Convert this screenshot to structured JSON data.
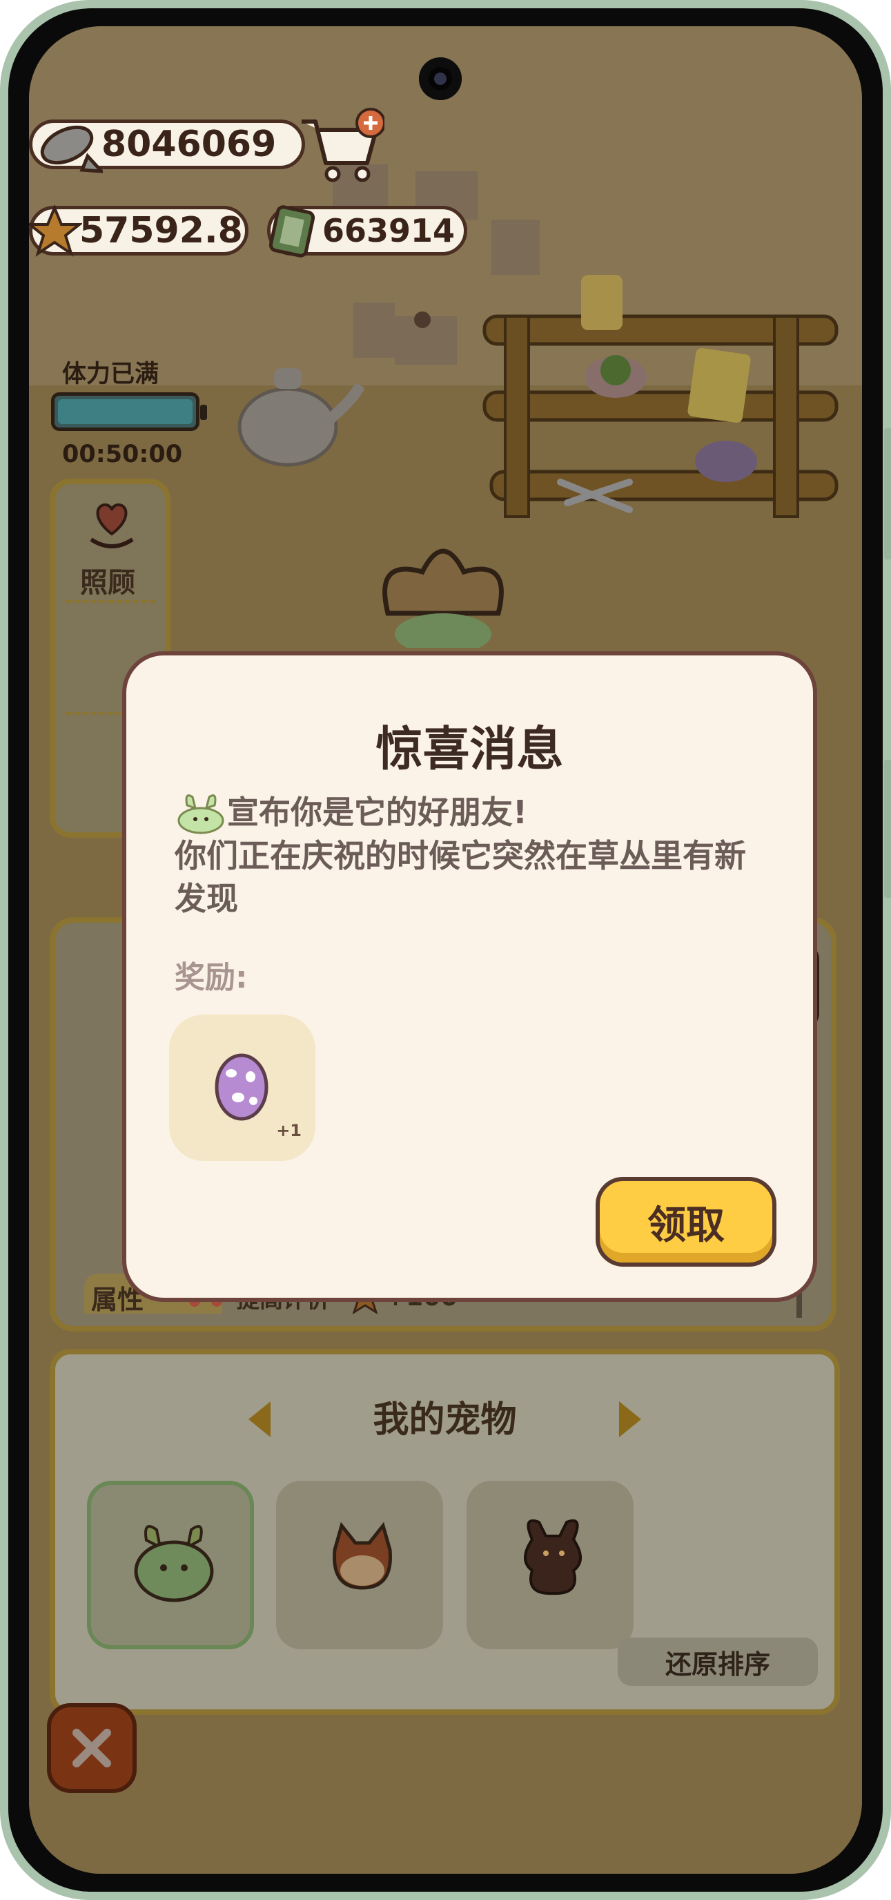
{
  "currencies": {
    "fish": "8046069",
    "stars": "57592.8",
    "tickets": "663914"
  },
  "stamina": {
    "label": "体力已满",
    "timer": "00:50:00",
    "level": 1.0
  },
  "side_menu": {
    "items": [
      {
        "label": "照顾"
      }
    ]
  },
  "attribute": {
    "tab_label": "属性",
    "improve_label": "提高评价",
    "bonus": "+100"
  },
  "pets_panel": {
    "title": "我的宠物",
    "restore_label": "还原排序"
  },
  "dialog": {
    "title": "惊喜消息",
    "message_line1": "宣布你是它的好朋友!",
    "message_line2": "你们正在庆祝的时候它突然在草丛里有新发现",
    "reward_label": "奖励:",
    "reward_count": "+1",
    "claim_label": "领取"
  },
  "colors": {
    "dialog_bg": "#fbf3e8",
    "dialog_border": "#6d433c",
    "claim_button": "#ffcd43",
    "title_text": "#3d2a22"
  }
}
